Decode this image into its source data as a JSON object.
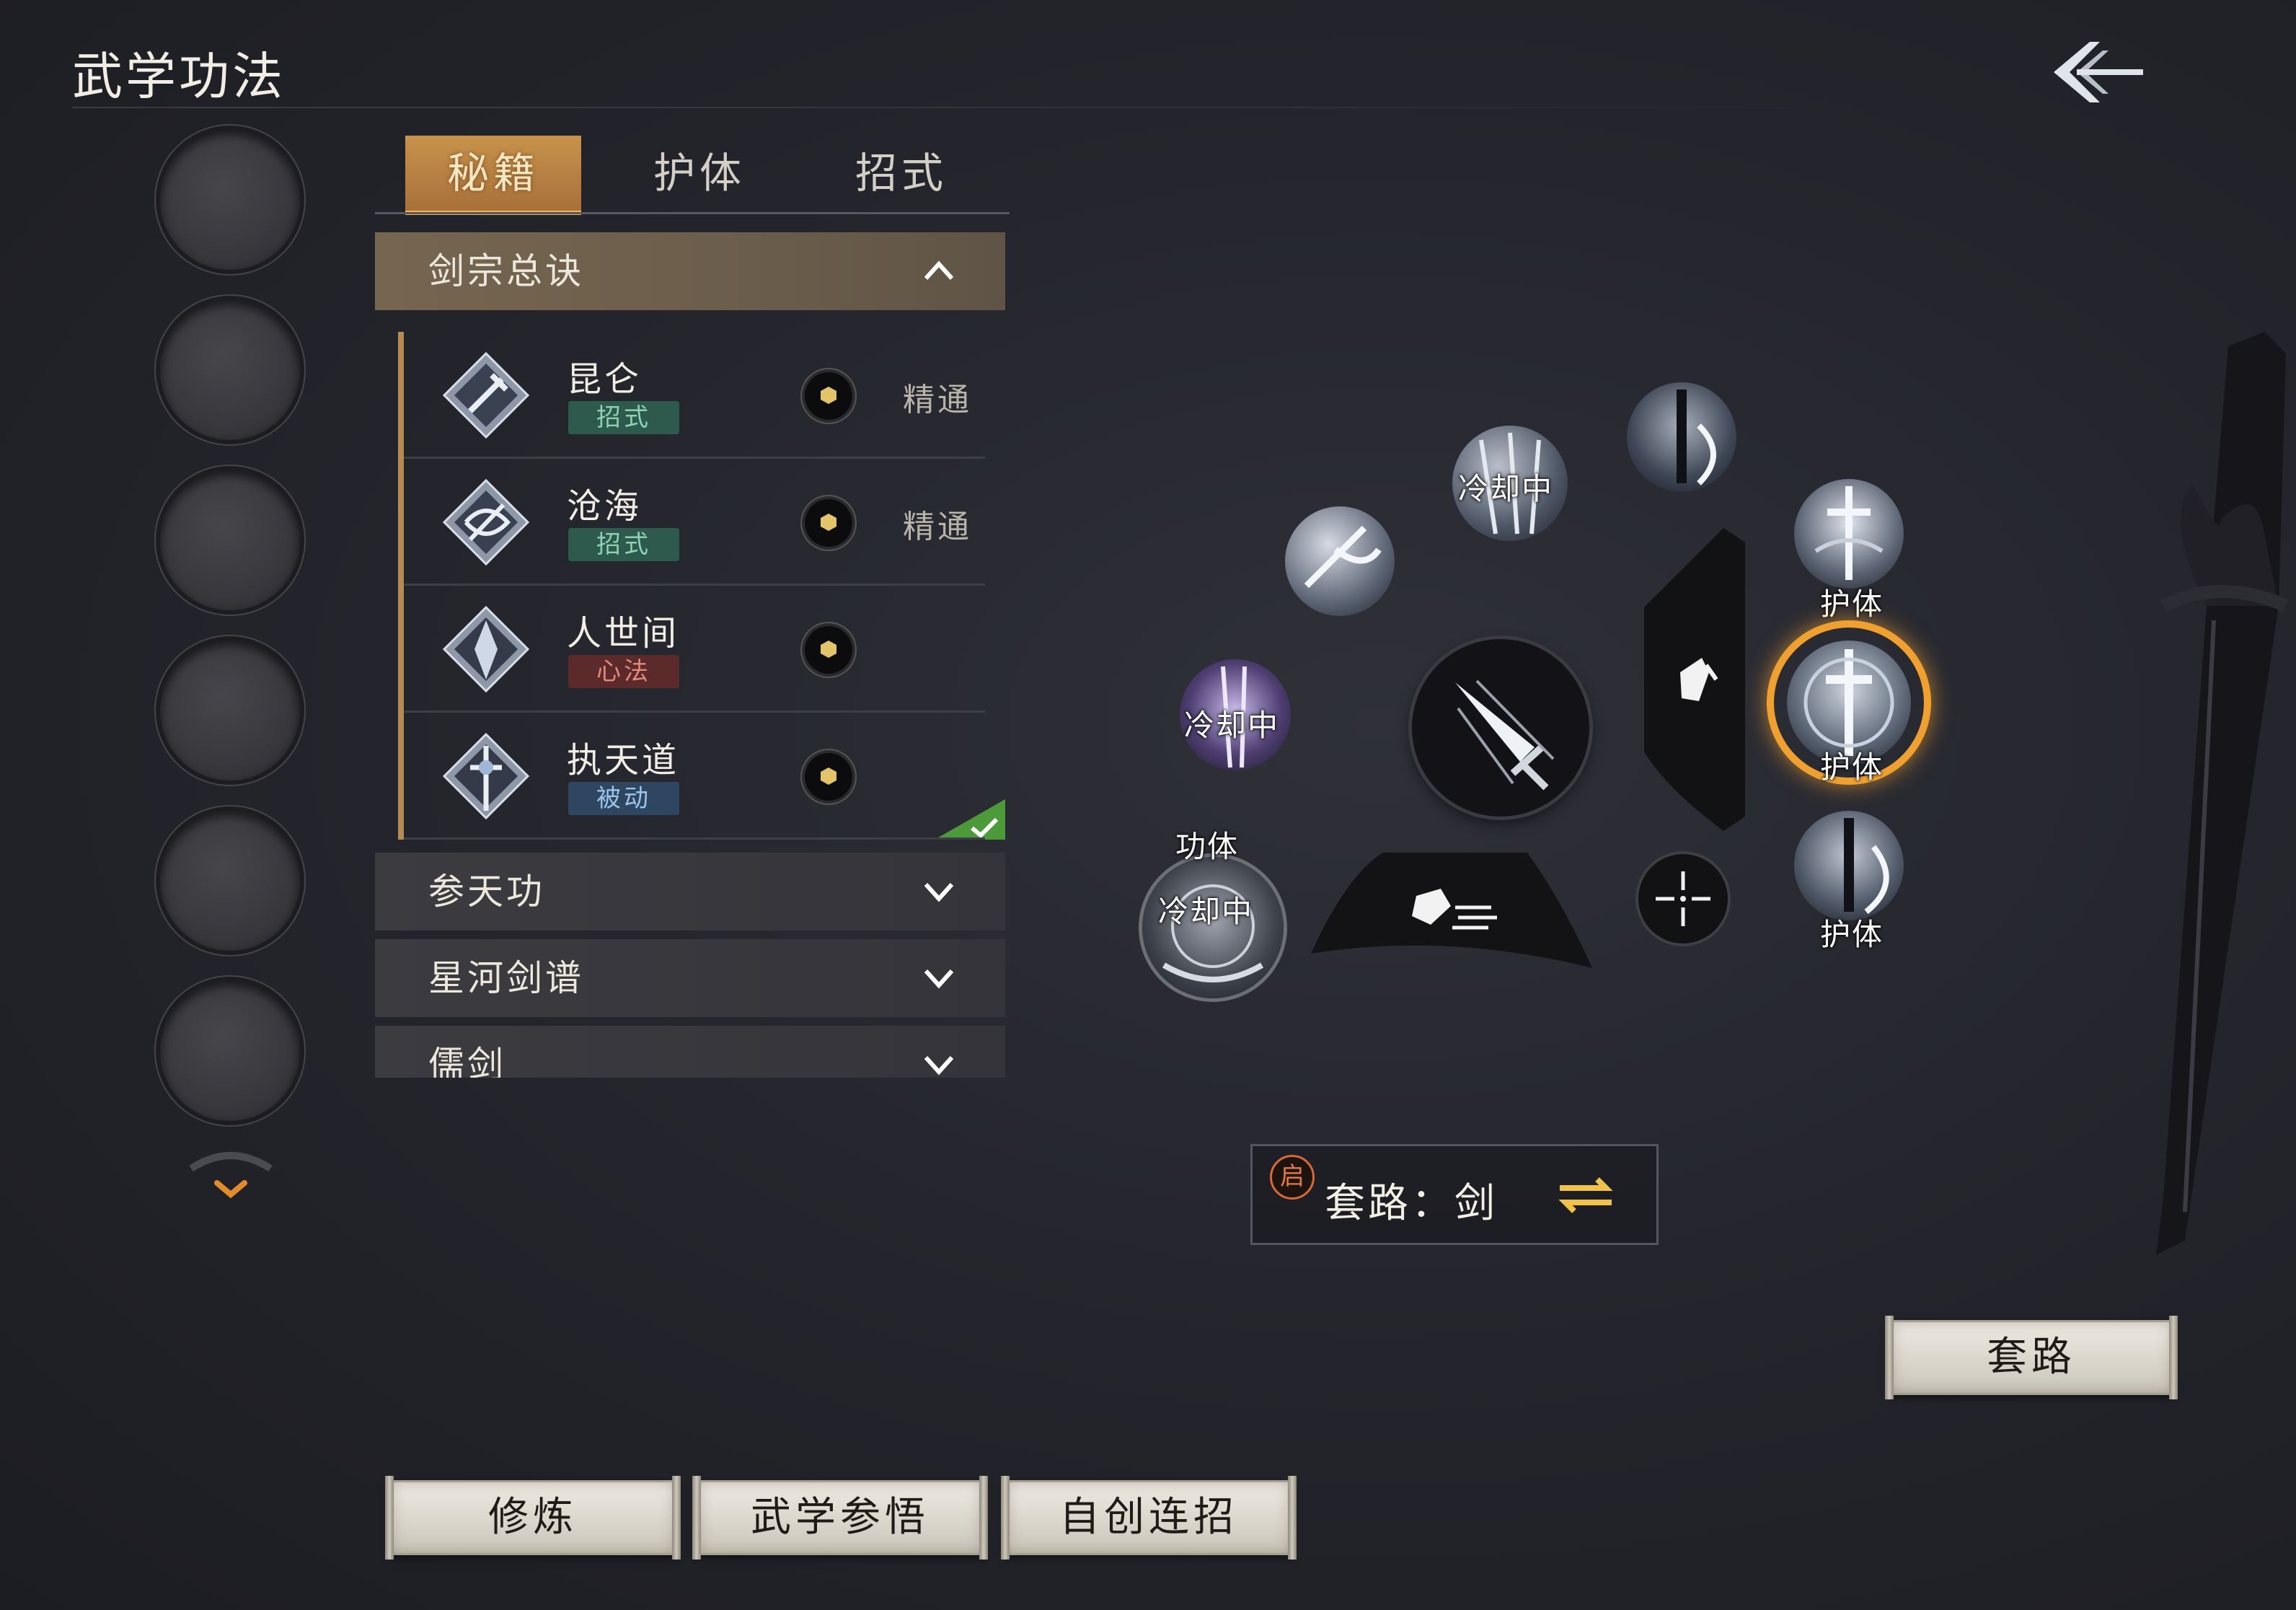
{
  "header": {
    "title": "武学功法"
  },
  "tabs": [
    {
      "label": "秘籍",
      "active": true
    },
    {
      "label": "护体",
      "active": false
    },
    {
      "label": "招式",
      "active": false
    }
  ],
  "sections": [
    {
      "name": "剑宗总诀",
      "expanded": true,
      "entries": [
        {
          "name": "昆仑",
          "tag": "招式",
          "tag_color": "#2e5a4e",
          "level": "精通"
        },
        {
          "name": "沧海",
          "tag": "招式",
          "tag_color": "#2e5a4e",
          "level": "精通"
        },
        {
          "name": "人世间",
          "tag": "心法",
          "tag_color": "#5c2a2a",
          "level": ""
        },
        {
          "name": "执天道",
          "tag": "被动",
          "tag_color": "#2f4660",
          "level": "",
          "equipped": true
        }
      ]
    },
    {
      "name": "参天功",
      "expanded": false
    },
    {
      "name": "星河剑谱",
      "expanded": false
    },
    {
      "name": "儒剑",
      "expanded": false
    }
  ],
  "wheel": {
    "labels": {
      "cooldown": "冷却中",
      "guard": "护体",
      "gongti": "功体"
    }
  },
  "path": {
    "badge": "启",
    "label": "套路：剑"
  },
  "buttons": {
    "path": "套路",
    "practice": "修炼",
    "comprehend": "武学参悟",
    "custom_combo": "自创连招"
  },
  "colors": {
    "accent_gold": "#c8924c",
    "selected_ring": "#f0a030",
    "equipped_check": "#4c9a3a"
  },
  "icons": [
    "back-arrow-icon",
    "chevron-up-icon",
    "chevron-down-icon",
    "swap-icon",
    "check-icon",
    "dash-icon",
    "dodge-icon",
    "crosshair-icon"
  ]
}
